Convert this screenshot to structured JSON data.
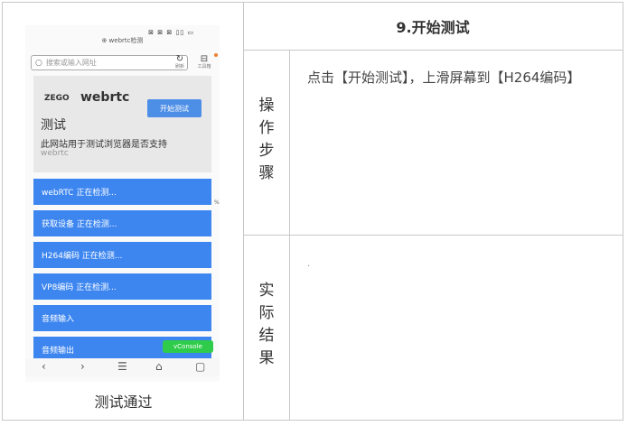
{
  "header": {
    "title": "9.开始测试"
  },
  "rows": {
    "steps": {
      "label": [
        "操",
        "作",
        "步",
        "骤"
      ],
      "content": "点击【开始测试】，上滑屏幕到【H264编码】"
    },
    "result": {
      "label": [
        "实",
        "际",
        "结",
        "果"
      ],
      "content": "."
    }
  },
  "caption": "测试通过",
  "screenshot": {
    "status_text": "⊠ ⊠ ⊠ ▯▯ ▭",
    "url": "⊕ webrtc检测",
    "search_placeholder": "搜索或输入网址",
    "toolbar": [
      {
        "icon": "refresh-icon",
        "glyph": "↻",
        "label": "刷新"
      },
      {
        "icon": "toolbox-icon",
        "glyph": "⊟",
        "label": "工具箱"
      }
    ],
    "card": {
      "brand": "ZEGO",
      "app": "webrtc",
      "start_button": "开始测试",
      "title": "测试",
      "description": "此网站用于测试浏览器是否支持",
      "subtext": "webrtc"
    },
    "items": [
      "webRTC 正在检测...",
      "获取设备 正在检测...",
      "H264编码 正在检测...",
      "VP8编码 正在检测...",
      "音频输入",
      "音频输出"
    ],
    "side_pct": "%",
    "vconsole": "vConsole",
    "navbar": [
      "‹",
      "›",
      "☰",
      "⌂",
      "▢"
    ],
    "colors": {
      "accent": "#3d86f0",
      "vconsole": "#2ecc4a",
      "card_bg": "#e8e8e8"
    }
  }
}
